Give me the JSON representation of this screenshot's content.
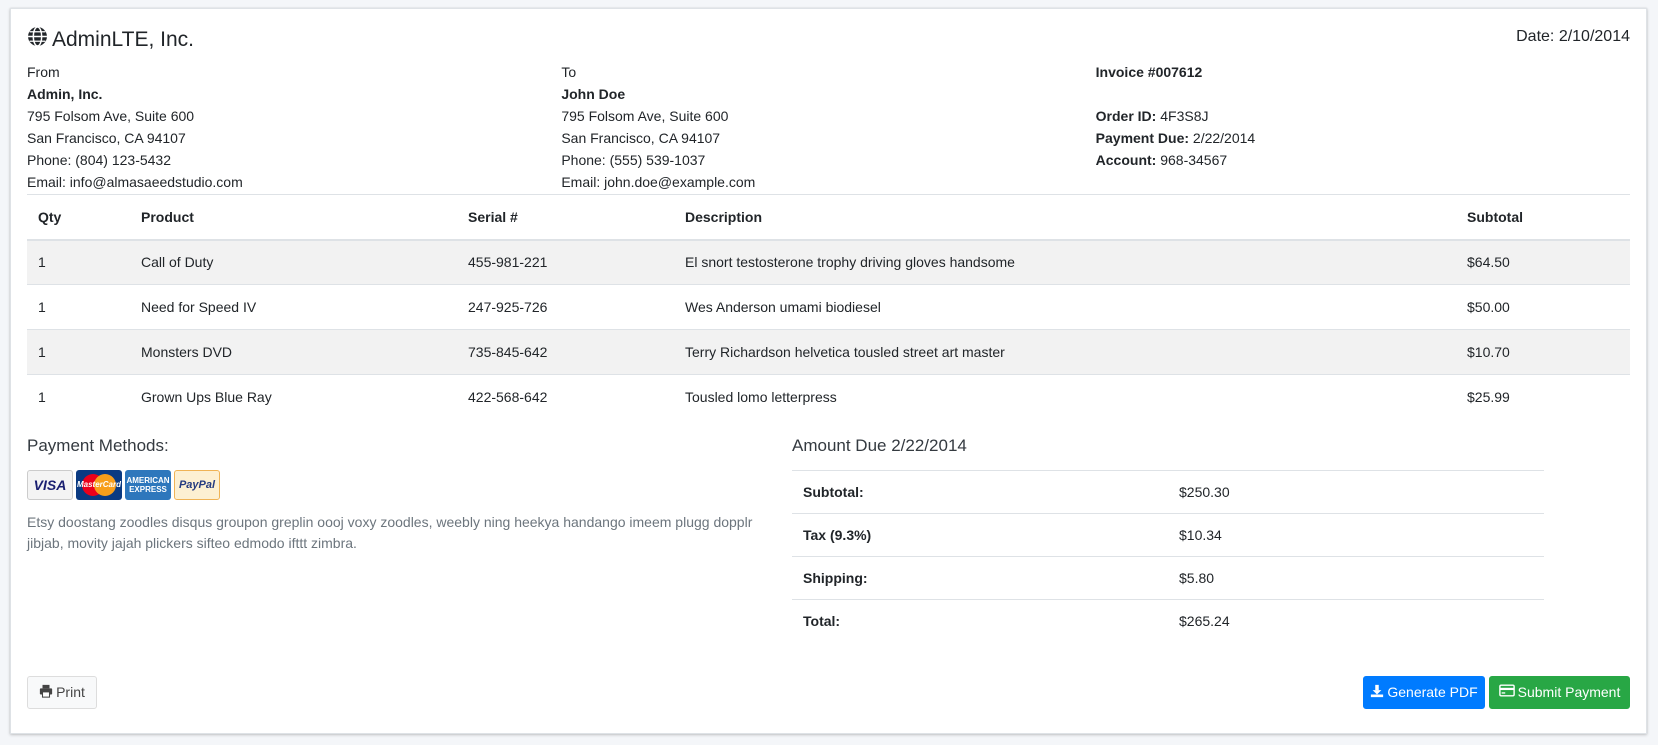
{
  "header": {
    "company": "AdminLTE, Inc.",
    "date_label": "Date: 2/10/2014"
  },
  "from": {
    "label": "From",
    "name": "Admin, Inc.",
    "address1": "795 Folsom Ave, Suite 600",
    "address2": "San Francisco, CA 94107",
    "phone": "Phone: (804) 123-5432",
    "email": "Email: info@almasaeedstudio.com"
  },
  "to": {
    "label": "To",
    "name": "John Doe",
    "address1": "795 Folsom Ave, Suite 600",
    "address2": "San Francisco, CA 94107",
    "phone": "Phone: (555) 539-1037",
    "email": "Email: john.doe@example.com"
  },
  "invoice_info": {
    "invoice_number": "Invoice #007612",
    "order_id_label": "Order ID:",
    "order_id": "4F3S8J",
    "payment_due_label": "Payment Due:",
    "payment_due": "2/22/2014",
    "account_label": "Account:",
    "account": "968-34567"
  },
  "table": {
    "headers": [
      "Qty",
      "Product",
      "Serial #",
      "Description",
      "Subtotal"
    ],
    "rows": [
      [
        "1",
        "Call of Duty",
        "455-981-221",
        "El snort testosterone trophy driving gloves handsome",
        "$64.50"
      ],
      [
        "1",
        "Need for Speed IV",
        "247-925-726",
        "Wes Anderson umami biodiesel",
        "$50.00"
      ],
      [
        "1",
        "Monsters DVD",
        "735-845-642",
        "Terry Richardson helvetica tousled street art master",
        "$10.70"
      ],
      [
        "1",
        "Grown Ups Blue Ray",
        "422-568-642",
        "Tousled lomo letterpress",
        "$25.99"
      ]
    ]
  },
  "payment": {
    "title": "Payment Methods:",
    "cards": {
      "visa": "VISA",
      "mastercard": "MasterCard",
      "amex": "AMERICAN EXPRESS",
      "paypal": "PayPal"
    },
    "note": "Etsy doostang zoodles disqus groupon greplin oooj voxy zoodles, weebly ning heekya handango imeem plugg dopplr jibjab, movity jajah plickers sifteo edmodo ifttt zimbra."
  },
  "amount_due": {
    "title": "Amount Due 2/22/2014",
    "rows": [
      {
        "label": "Subtotal:",
        "value": "$250.30"
      },
      {
        "label": "Tax (9.3%)",
        "value": "$10.34"
      },
      {
        "label": "Shipping:",
        "value": "$5.80"
      },
      {
        "label": "Total:",
        "value": "$265.24"
      }
    ]
  },
  "actions": {
    "print": "Print",
    "generate_pdf": "Generate PDF",
    "submit_payment": "Submit Payment"
  },
  "colors": {
    "primary": "#007bff",
    "success": "#28a745"
  }
}
